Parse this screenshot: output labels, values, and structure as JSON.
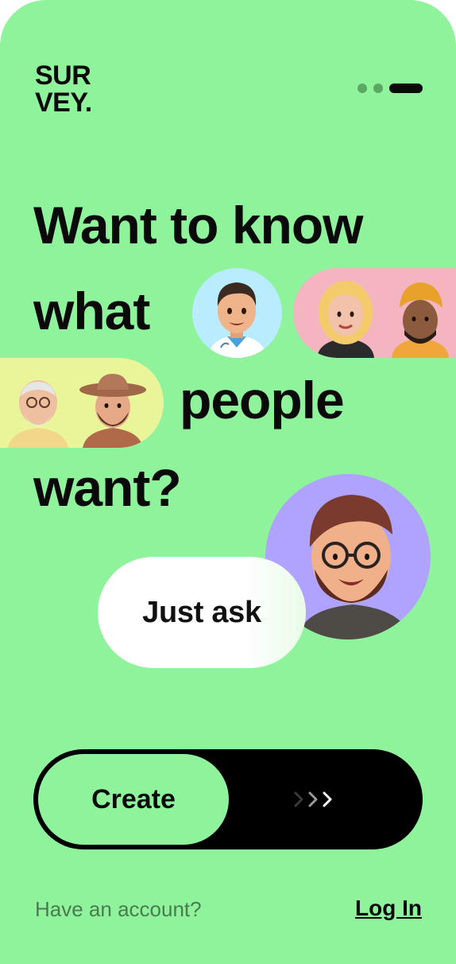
{
  "brand": {
    "line1": "SUR",
    "line2": "VEY."
  },
  "pager": {
    "pages": 3,
    "active_index": 2
  },
  "headline": {
    "line1": "Want to know",
    "line2": "what",
    "line3": "people",
    "line4": "want?"
  },
  "ask_bubble": {
    "label": "Just ask"
  },
  "slider": {
    "label": "Create",
    "icon": "triple-chevron-right-icon"
  },
  "footer": {
    "prompt": "Have an account?",
    "login_label": "Log In"
  },
  "colors": {
    "background": "#8ef39b",
    "text": "#0a0a0a",
    "pill_pink": "#f4b4c0",
    "pill_yellow": "#eaf59a",
    "circle_blue": "#b9ecff",
    "circle_purple": "#b0a2ff"
  }
}
